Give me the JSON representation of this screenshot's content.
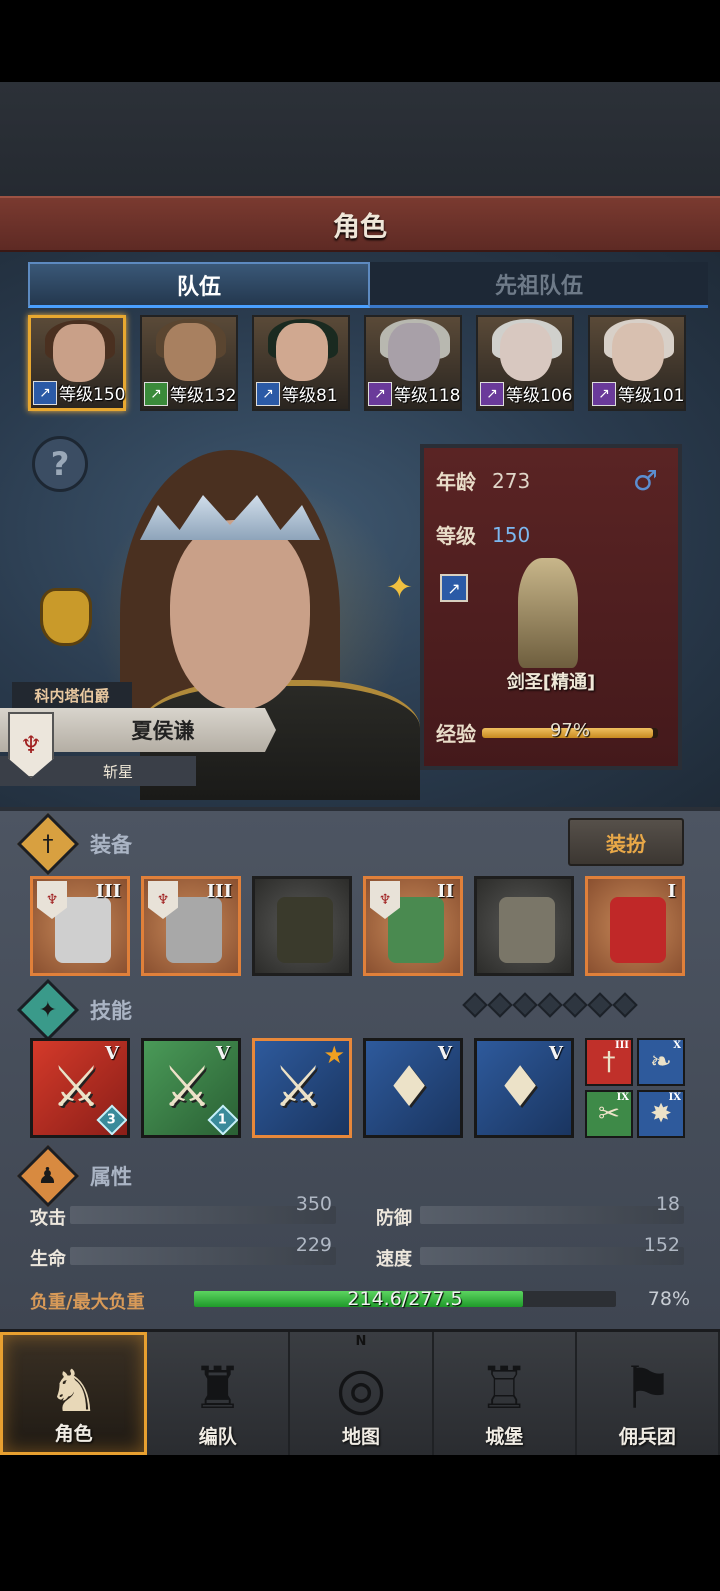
{
  "header": {
    "title": "角色"
  },
  "tabs": [
    {
      "label": "队伍",
      "active": true
    },
    {
      "label": "先祖队伍",
      "active": false
    }
  ],
  "party": [
    {
      "level_text": "等级150",
      "class_color": "#2b5aa6",
      "icon": "sword-class-icon",
      "selected": true
    },
    {
      "level_text": "等级132",
      "class_color": "#3a8a3a",
      "icon": "sword-class-icon",
      "selected": false
    },
    {
      "level_text": "等级81",
      "class_color": "#2b5aa6",
      "icon": "sword-class-icon",
      "selected": false
    },
    {
      "level_text": "等级118",
      "class_color": "#6a3a9a",
      "icon": "staff-class-icon",
      "selected": false
    },
    {
      "level_text": "等级106",
      "class_color": "#6a3a9a",
      "icon": "staff-class-icon",
      "selected": false
    },
    {
      "level_text": "等级101",
      "class_color": "#6a3a9a",
      "icon": "staff-class-icon",
      "selected": false
    }
  ],
  "hero": {
    "title": "科内塔伯爵",
    "name": "夏侯谦",
    "subtitle": "斩星"
  },
  "info": {
    "age_label": "年龄",
    "age": "273",
    "level_label": "等级",
    "level": "150",
    "gender": "♂",
    "class_name": "剑圣[精通]",
    "exp_label": "经验",
    "exp_percent_text": "97%",
    "exp_fraction": 0.97
  },
  "equipment": {
    "title": "装备",
    "dress_button": "装扮",
    "items": [
      {
        "name": "axe-weapon",
        "rank": "III",
        "rarity": "orange",
        "crest": true,
        "color": "#cfcfcf"
      },
      {
        "name": "axe-weapon",
        "rank": "III",
        "rarity": "orange",
        "crest": true,
        "color": "#a8a8a8"
      },
      {
        "name": "hood",
        "rank": "",
        "rarity": "gray",
        "crest": false,
        "color": "#3a3a2c"
      },
      {
        "name": "armor",
        "rank": "II",
        "rarity": "orange",
        "crest": true,
        "color": "#4a8a50"
      },
      {
        "name": "boots",
        "rank": "",
        "rarity": "gray",
        "crest": false,
        "color": "#7a7668"
      },
      {
        "name": "charm-knot",
        "rank": "I",
        "rarity": "orange",
        "crest": false,
        "color": "#c02828"
      }
    ]
  },
  "skills": {
    "title": "技能",
    "slots_total": 7,
    "items": [
      {
        "name": "skill-red-slash",
        "color": "red",
        "rank": "V",
        "count": "3",
        "glyph": "⚔",
        "starred": false
      },
      {
        "name": "skill-green-slash",
        "color": "green",
        "rank": "V",
        "count": "1",
        "glyph": "⚔",
        "starred": false
      },
      {
        "name": "skill-blue-strike",
        "color": "blue",
        "rank": "",
        "count": "",
        "glyph": "⚔",
        "starred": true
      },
      {
        "name": "skill-blue-gem-sword",
        "color": "blue",
        "rank": "V",
        "count": "",
        "glyph": "♦",
        "starred": false
      },
      {
        "name": "skill-blue-gem-claw",
        "color": "blue",
        "rank": "V",
        "count": "",
        "glyph": "♦",
        "starred": false
      }
    ],
    "mini": [
      {
        "name": "mini-skill-sword",
        "color": "#c0302a",
        "rank": "III",
        "glyph": "†"
      },
      {
        "name": "mini-skill-claw",
        "color": "#2e5a9c",
        "rank": "X",
        "glyph": "❧"
      },
      {
        "name": "mini-skill-green",
        "color": "#3e8a48",
        "rank": "IX",
        "glyph": "✂"
      },
      {
        "name": "mini-skill-burst",
        "color": "#2e5a9c",
        "rank": "IX",
        "glyph": "✸"
      }
    ]
  },
  "attributes": {
    "title": "属性",
    "attack_label": "攻击",
    "attack": "350",
    "defense_label": "防御",
    "defense": "18",
    "hp_label": "生命",
    "hp": "229",
    "speed_label": "速度",
    "speed": "152",
    "load_label": "负重/最大负重",
    "load_text": "214.6/277.5",
    "load_percent_text": "78%",
    "load_fraction": 0.78
  },
  "nav": [
    {
      "label": "角色",
      "icon": "knight-icon",
      "active": true
    },
    {
      "label": "编队",
      "icon": "formation-icon",
      "active": false
    },
    {
      "label": "地图",
      "icon": "compass-map-icon",
      "active": false
    },
    {
      "label": "城堡",
      "icon": "castle-icon",
      "active": false
    },
    {
      "label": "佣兵团",
      "icon": "mercenary-banner-icon",
      "active": false
    }
  ],
  "nav_compass_letter": "N"
}
